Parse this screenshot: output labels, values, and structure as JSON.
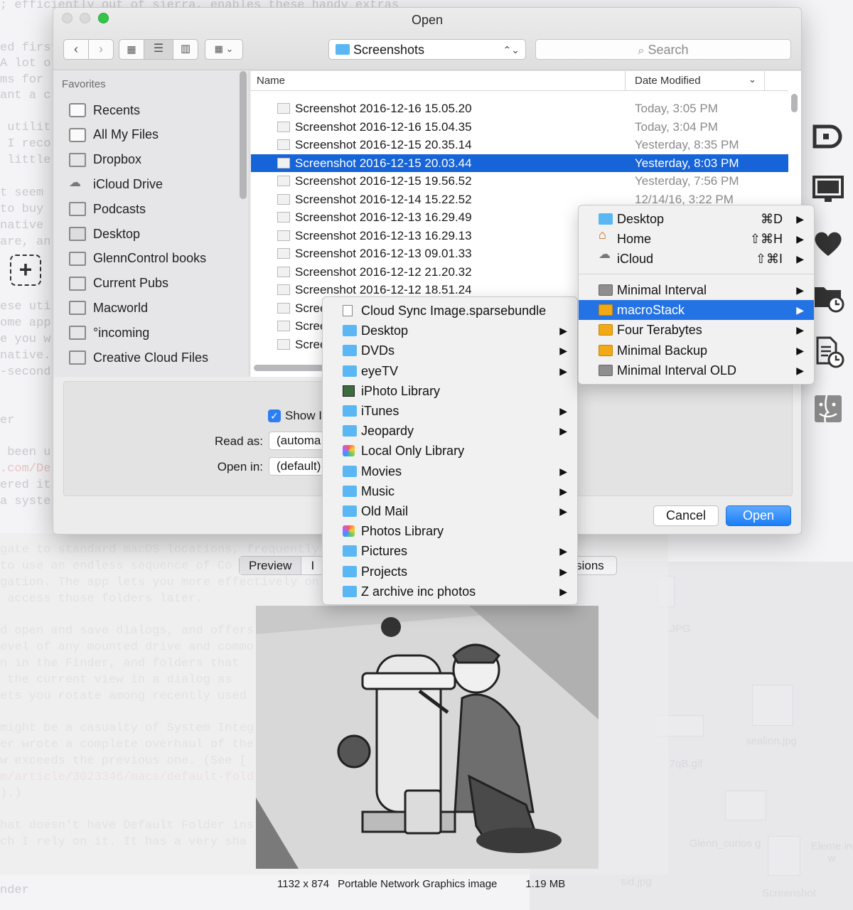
{
  "window": {
    "title": "Open",
    "location": "Screenshots",
    "search_placeholder": "Search",
    "traffic_colors": [
      "#d9d9d9",
      "#d9d9d9",
      "#34c648"
    ]
  },
  "sidebar": {
    "heading": "Favorites",
    "items": [
      {
        "label": "Recents",
        "icon": "recents-icon"
      },
      {
        "label": "All My Files",
        "icon": "all-files-icon"
      },
      {
        "label": "Dropbox",
        "icon": "folder-icon"
      },
      {
        "label": "iCloud Drive",
        "icon": "cloud-icon"
      },
      {
        "label": "Podcasts",
        "icon": "folder-icon"
      },
      {
        "label": "Desktop",
        "icon": "desktop-icon"
      },
      {
        "label": "GlennControl books",
        "icon": "folder-icon"
      },
      {
        "label": "Current Pubs",
        "icon": "folder-icon"
      },
      {
        "label": "Macworld",
        "icon": "folder-icon"
      },
      {
        "label": "°incoming",
        "icon": "folder-icon"
      },
      {
        "label": "Creative Cloud Files",
        "icon": "folder-icon"
      }
    ]
  },
  "list": {
    "col_name": "Name",
    "col_date": "Date Modified",
    "rows": [
      {
        "name": "Screenshot 2016-12-16 15.05.20",
        "date": "Today, 3:05 PM"
      },
      {
        "name": "Screenshot 2016-12-16 15.04.35",
        "date": "Today, 3:04 PM"
      },
      {
        "name": "Screenshot 2016-12-15 20.35.14",
        "date": "Yesterday, 8:35 PM"
      },
      {
        "name": "Screenshot 2016-12-15 20.03.44",
        "date": "Yesterday, 8:03 PM"
      },
      {
        "name": "Screenshot 2016-12-15 19.56.52",
        "date": "Yesterday, 7:56 PM"
      },
      {
        "name": "Screenshot 2016-12-14 15.22.52",
        "date": "12/14/16, 3:22 PM"
      },
      {
        "name": "Screenshot 2016-12-13 16.29.49",
        "date": ""
      },
      {
        "name": "Screenshot 2016-12-13 16.29.13",
        "date": ""
      },
      {
        "name": "Screenshot 2016-12-13 09.01.33",
        "date": ""
      },
      {
        "name": "Screenshot 2016-12-12 21.20.32",
        "date": ""
      },
      {
        "name": "Screenshot 2016-12-12 18.51.24",
        "date": ""
      },
      {
        "name": "Scree",
        "date": ""
      },
      {
        "name": "Scree",
        "date": ""
      },
      {
        "name": "Scree",
        "date": ""
      }
    ],
    "selected_index": 3
  },
  "options": {
    "show_label": "Show I",
    "read_as_label": "Read as:",
    "read_as_value": "(automa",
    "open_in_label": "Open in:",
    "open_in_value": "(default)"
  },
  "buttons": {
    "cancel": "Cancel",
    "open": "Open"
  },
  "folder_menu": {
    "items": [
      {
        "label": "Cloud Sync Image.sparsebundle",
        "icon": "document-icon",
        "submenu": false
      },
      {
        "label": "Desktop",
        "icon": "folder-icon",
        "submenu": true
      },
      {
        "label": "DVDs",
        "icon": "folder-icon",
        "submenu": true
      },
      {
        "label": "eyeTV",
        "icon": "folder-icon",
        "submenu": true
      },
      {
        "label": "iPhoto Library",
        "icon": "iphoto-icon",
        "submenu": false
      },
      {
        "label": "iTunes",
        "icon": "folder-icon",
        "submenu": true
      },
      {
        "label": "Jeopardy",
        "icon": "folder-icon",
        "submenu": true
      },
      {
        "label": "Local Only Library",
        "icon": "photos-icon",
        "submenu": false
      },
      {
        "label": "Movies",
        "icon": "folder-icon",
        "submenu": true
      },
      {
        "label": "Music",
        "icon": "folder-icon",
        "submenu": true
      },
      {
        "label": "Old Mail",
        "icon": "folder-icon",
        "submenu": true
      },
      {
        "label": "Photos Library",
        "icon": "photos-icon",
        "submenu": false
      },
      {
        "label": "Pictures",
        "icon": "folder-icon",
        "submenu": true
      },
      {
        "label": "Projects",
        "icon": "folder-icon",
        "submenu": true
      },
      {
        "label": "Z archive inc photos",
        "icon": "folder-icon",
        "submenu": true
      }
    ]
  },
  "locations_menu": {
    "top": [
      {
        "label": "Desktop",
        "shortcut": "⌘D",
        "icon": "folder-icon"
      },
      {
        "label": "Home",
        "shortcut": "⇧⌘H",
        "icon": "home-icon"
      },
      {
        "label": "iCloud",
        "shortcut": "⇧⌘I",
        "icon": "cloud-icon"
      }
    ],
    "volumes": [
      {
        "label": "Minimal Interval",
        "icon": "grey-drive-icon"
      },
      {
        "label": "macroStack",
        "icon": "drive-icon"
      },
      {
        "label": "Four Terabytes",
        "icon": "drive-icon"
      },
      {
        "label": "Minimal Backup",
        "icon": "drive-icon"
      },
      {
        "label": "Minimal Interval OLD",
        "icon": "grey-drive-icon"
      }
    ],
    "highlighted": "macroStack"
  },
  "preview": {
    "tab_active": "Preview",
    "tab_second": "I",
    "tab_right": "sions",
    "dimensions": "1132 x 874",
    "kind": "Portable Network Graphics image",
    "size": "1.19 MB"
  },
  "accent_color": "#1664d7"
}
